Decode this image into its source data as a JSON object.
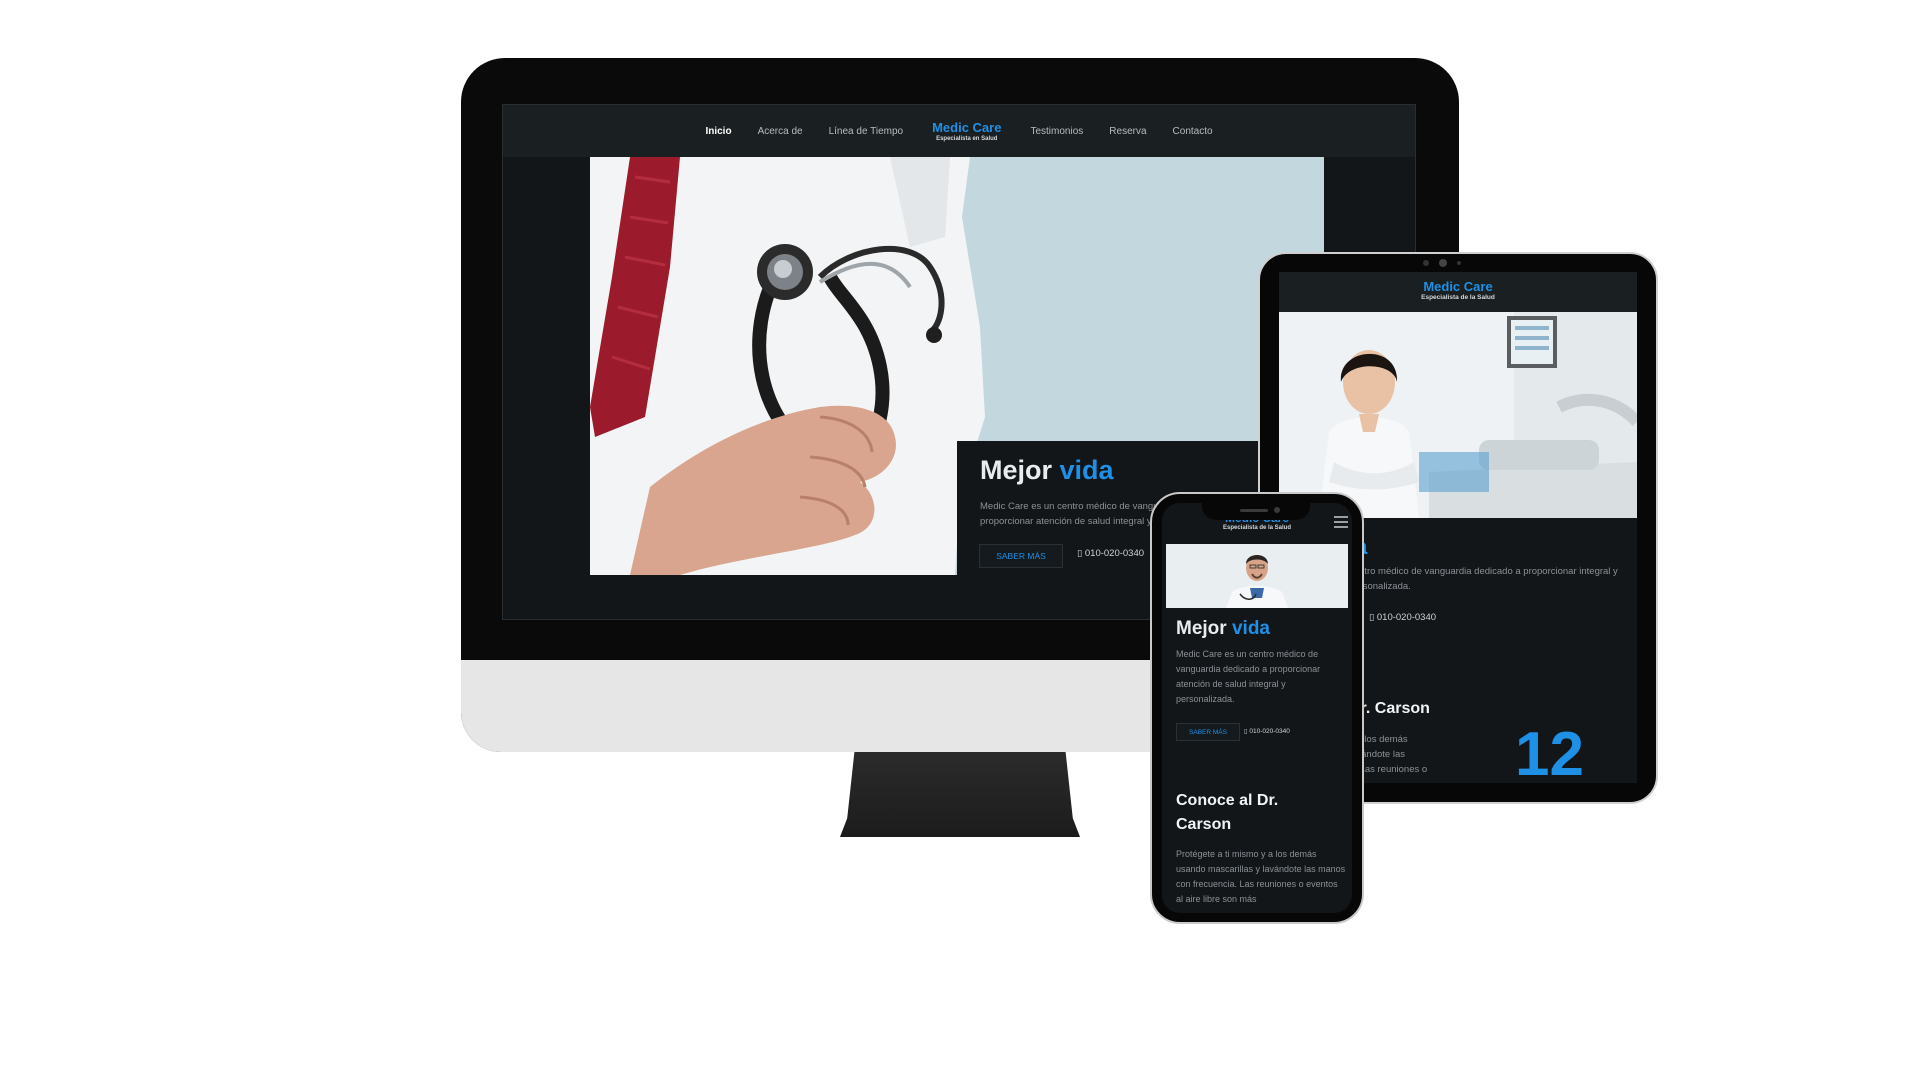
{
  "brand": {
    "name": "Medic Care",
    "tagline_desktop": "Especialista en Salud",
    "tagline_mobile": "Especialista de la Salud"
  },
  "nav": {
    "items": [
      "Inicio",
      "Acerca de",
      "Línea de Tiempo",
      "Testimonios",
      "Reserva",
      "Contacto"
    ],
    "active": "Inicio"
  },
  "hero": {
    "title_a": "Mejor",
    "title_b": "vida",
    "desc_desktop": "Medic Care es un centro médico de vanguardia dedicado a proporcionar atención de salud integral y personalizada.",
    "desc_mobile": "Medic Care es un centro médico de vanguardia dedicado a proporcionar atención de salud integral y personalizada.",
    "button": "SABER MÁS",
    "phone": "010-020-0340"
  },
  "tablet": {
    "title_partial": "ía",
    "desc_partial": "centro médico de vanguardia dedicado a proporcionar integral y personalizada.",
    "phone": "010-020-0340",
    "doctor_partial": "Dr. Carson",
    "text_partial_1": "y a los demás",
    "text_partial_2": "lavándote las",
    "text_partial_3": "n. Las reuniones o",
    "big_number": "12"
  },
  "mobile": {
    "section_title": "Conoce al Dr. Carson",
    "section_text": "Protégete a ti mismo y a los demás usando mascarillas y lavándote las manos con frecuencia. Las reuniones o eventos al aire libre son más"
  },
  "colors": {
    "accent": "#1e90e6",
    "dark_bg": "#121619",
    "nav_bg": "#1a1f21"
  }
}
